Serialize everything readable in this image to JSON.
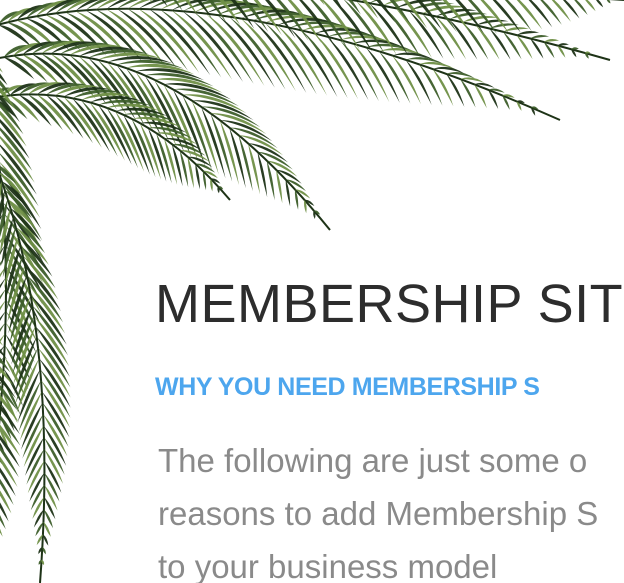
{
  "header": {
    "title": "MEMBERSHIP SIT",
    "subtitle": "WHY YOU NEED MEMBERSHIP S"
  },
  "content": {
    "lines": [
      "The following are just some o",
      "reasons to add Membership S",
      "to your business model"
    ]
  },
  "colors": {
    "title": "#2d2d2d",
    "subtitle": "#4da6ee",
    "body": "#8a8a8a",
    "leaf_dark": "#1e3317",
    "leaf_mid": "#3d5e2a",
    "leaf_light": "#6f8f46"
  },
  "decoration": {
    "icon": "palm-leaves-icon"
  }
}
